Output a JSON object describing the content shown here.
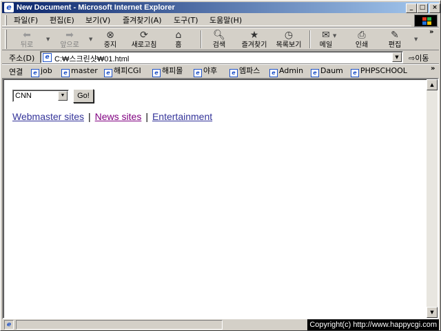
{
  "window": {
    "title": "New Document - Microsoft Internet Explorer",
    "buttons": {
      "minimize": "_",
      "maximize": "□",
      "close": "×"
    }
  },
  "menu": [
    {
      "label": "파일(F)"
    },
    {
      "label": "편집(E)"
    },
    {
      "label": "보기(V)"
    },
    {
      "label": "즐겨찾기(A)"
    },
    {
      "label": "도구(T)"
    },
    {
      "label": "도움말(H)"
    }
  ],
  "toolbar": {
    "back": {
      "label": "뒤로",
      "icon": "back-arrow-icon"
    },
    "forward": {
      "label": "앞으로",
      "icon": "forward-arrow-icon"
    },
    "stop": {
      "label": "중지",
      "icon": "stop-icon"
    },
    "refresh": {
      "label": "새로고침",
      "icon": "refresh-icon"
    },
    "home": {
      "label": "홈",
      "icon": "home-icon"
    },
    "search": {
      "label": "검색",
      "icon": "search-icon"
    },
    "favorites": {
      "label": "즐겨찾기",
      "icon": "favorites-icon"
    },
    "history": {
      "label": "목록보기",
      "icon": "history-icon"
    },
    "mail": {
      "label": "메일",
      "icon": "mail-icon"
    },
    "print": {
      "label": "인쇄",
      "icon": "print-icon"
    },
    "edit": {
      "label": "편집",
      "icon": "edit-icon"
    }
  },
  "address": {
    "label": "주소(D)",
    "value": "C:₩스크린샷₩01.html",
    "go_label": "이동"
  },
  "links": {
    "label": "연결",
    "items": [
      "job",
      "master",
      "해피CGI",
      "해피몰",
      "야후",
      "엠파스",
      "Admin",
      "Daum",
      "PHPSCHOOL"
    ]
  },
  "page": {
    "select_value": "CNN",
    "go_button": "Go!",
    "nav": {
      "webmaster": "Webmaster sites",
      "news": "News sites",
      "entertainment": "Entertainment",
      "separator": "|"
    }
  },
  "status": {
    "copyright": "Copyright(c) http://www.happycgi.com"
  },
  "colors": {
    "link": "#333399",
    "visited_link": "#800080",
    "titlebar_start": "#0a246a",
    "titlebar_end": "#a6caf0"
  }
}
